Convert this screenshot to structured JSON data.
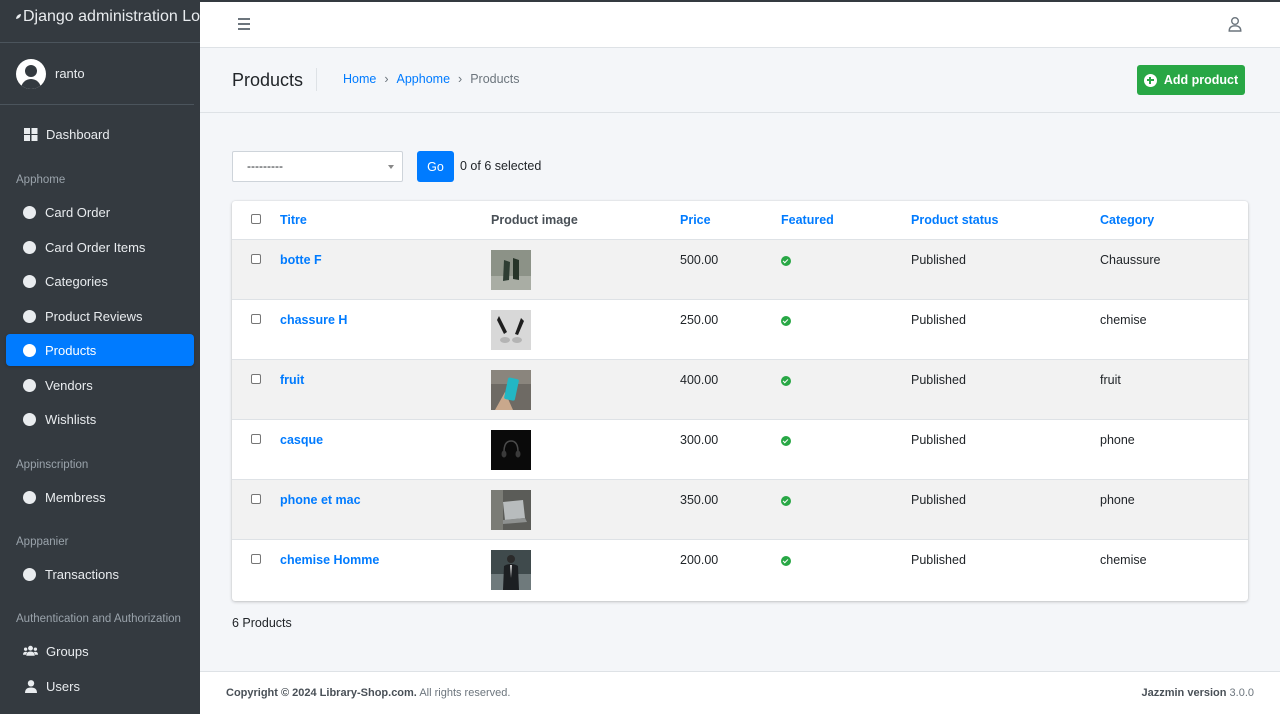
{
  "brand": {
    "title": "Django administration Lo"
  },
  "user": {
    "name": "ranto"
  },
  "sidebar": {
    "dashboard": "Dashboard",
    "sections": [
      {
        "header": "Apphome",
        "items": [
          "Card Order",
          "Card Order Items",
          "Categories",
          "Product Reviews",
          "Products",
          "Vendors",
          "Wishlists"
        ]
      },
      {
        "header": "Appinscription",
        "items": [
          "Membress"
        ]
      },
      {
        "header": "Apppanier",
        "items": [
          "Transactions"
        ]
      },
      {
        "header": "Authentication and Authorization",
        "items": [
          "Groups",
          "Users"
        ]
      }
    ],
    "active_item": "Products"
  },
  "header": {
    "title": "Products",
    "breadcrumb": [
      "Home",
      "Apphome",
      "Products"
    ],
    "add_button": "Add product"
  },
  "actions": {
    "select_value": "---------",
    "go_label": "Go",
    "selected_text": "0 of 6 selected"
  },
  "table": {
    "columns": [
      "Titre",
      "Product image",
      "Price",
      "Featured",
      "Product status",
      "Category"
    ],
    "rows": [
      {
        "title": "botte F",
        "image": "green-boots",
        "price": "500.00",
        "featured": true,
        "status": "Published",
        "category": "Chaussure"
      },
      {
        "title": "chassure H",
        "image": "black-heels",
        "price": "250.00",
        "featured": true,
        "status": "Published",
        "category": "chemise"
      },
      {
        "title": "fruit",
        "image": "phone-in-hand",
        "price": "400.00",
        "featured": true,
        "status": "Published",
        "category": "fruit"
      },
      {
        "title": "casque",
        "image": "headphones",
        "price": "300.00",
        "featured": true,
        "status": "Published",
        "category": "phone"
      },
      {
        "title": "phone et mac",
        "image": "laptop",
        "price": "350.00",
        "featured": true,
        "status": "Published",
        "category": "phone"
      },
      {
        "title": "chemise Homme",
        "image": "suit-man",
        "price": "200.00",
        "featured": true,
        "status": "Published",
        "category": "chemise"
      }
    ]
  },
  "total": "6 Products",
  "footer": {
    "copyright_bold": "Copyright © 2024 Library-Shop.com.",
    "copyright_rest": " All rights reserved.",
    "version_bold": "Jazzmin version",
    "version": " 3.0.0"
  },
  "colors": {
    "primary": "#007bff",
    "success": "#28a745",
    "sidebar": "#343a40"
  }
}
